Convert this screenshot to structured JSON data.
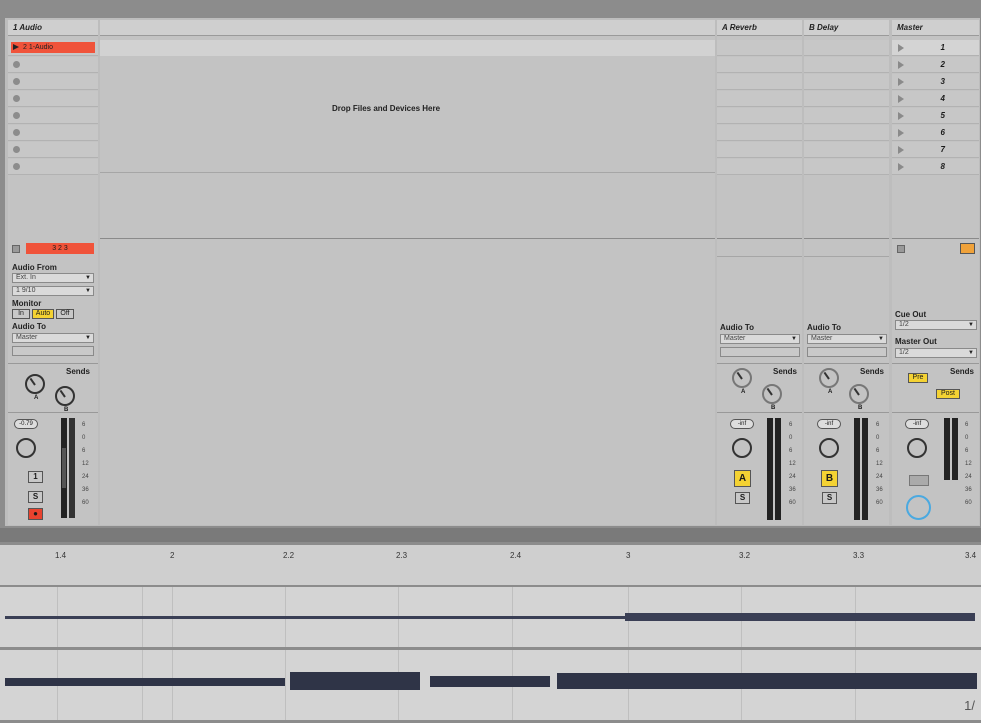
{
  "tracks": {
    "audio": {
      "title": "1 Audio",
      "clip_label": "2 1-Audio",
      "clip_launch": "3 2 3"
    },
    "reverb": {
      "title": "A Reverb"
    },
    "delay": {
      "title": "B Delay"
    },
    "master": {
      "title": "Master",
      "scenes": [
        "1",
        "2",
        "3",
        "4",
        "5",
        "6",
        "7",
        "8"
      ]
    }
  },
  "drop_zone": {
    "text": "Drop Files and Devices Here"
  },
  "io": {
    "audio_from_label": "Audio From",
    "audio_from_value": "Ext. In",
    "audio_from_channel": "1 9/10",
    "monitor_label": "Monitor",
    "monitor_in": "In",
    "monitor_auto": "Auto",
    "monitor_off": "Off",
    "audio_to_label": "Audio To",
    "audio_to_value": "Master",
    "reverb_audio_to_label": "Audio To",
    "reverb_audio_to_value": "Master",
    "delay_audio_to_label": "Audio To",
    "delay_audio_to_value": "Master",
    "cue_out_label": "Cue Out",
    "cue_out_value": "1/2",
    "master_out_label": "Master Out",
    "master_out_value": "1/2"
  },
  "sends": {
    "label": "Sends",
    "knob_a": "A",
    "knob_b": "B",
    "master_pre": "Pre",
    "master_post": "Post"
  },
  "mixer": {
    "audio_volume": "-0.79",
    "reverb_volume": "-inf",
    "delay_volume": "-inf",
    "master_volume": "-inf",
    "audio_track_number": "1",
    "solo": "S",
    "reverb_activator": "A",
    "delay_activator": "B",
    "scale": [
      "6",
      "0",
      "6",
      "12",
      "24",
      "36",
      "60"
    ]
  },
  "timeline": {
    "ticks": [
      "1.4",
      "2",
      "2.2",
      "2.3",
      "2.4",
      "3",
      "3.2",
      "3.3",
      "3.4"
    ],
    "page_indicator": "1/"
  },
  "colors": {
    "clip": "#f0533a",
    "active": "#f4d233",
    "background": "#c3c3c3"
  }
}
